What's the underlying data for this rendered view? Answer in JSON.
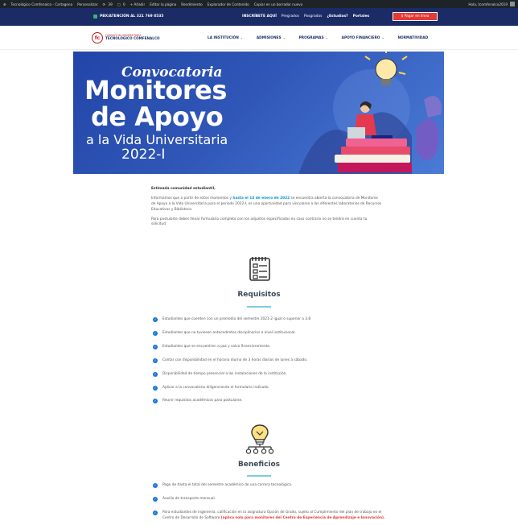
{
  "admin_bar": {
    "items": [
      "Tecnológico Comfenalco - Cartagena",
      "Personalizar",
      "39",
      "0",
      "+ Añadir",
      "Editar la página",
      "Rendimiento",
      "Explorador de Contenido",
      "Copiar en un borrador nuevo"
    ],
    "greeting": "Hola, tcomfenalco2019"
  },
  "topbar": {
    "pbx": "PBX/ATENCIÓN AL 321 769 8535",
    "signup_label": "INSCRÍBETE AQUÍ",
    "links": [
      "Pregrados",
      "Posgrados",
      "¿Estudias?",
      "Portales"
    ],
    "enroll_button": "$ Pagar en línea"
  },
  "navbar": {
    "logo_line1": "FUNDACIÓN UNIVERSITARIA",
    "logo_line2": "TECNOLÓGICO COMFENALCO",
    "menu": [
      "LA INSTITUCIÓN",
      "ADMISIONES",
      "PROGRAMAS",
      "APOYO FINANCIERO",
      "NORMATIVIDAD"
    ],
    "menu_has_caret": [
      true,
      true,
      true,
      true,
      false
    ]
  },
  "hero": {
    "line1": "Convocatoria",
    "line2": "Monitores",
    "line3": "de Apoyo",
    "line4": "a la Vida Universitaria",
    "line5": "2022-I"
  },
  "intro": {
    "greeting": "Estimada comunidad estudiantil,",
    "p1_a": "Informamos que a partir de estos momentos y ",
    "p1_highlight": "hasta el 14 de enero de 2022",
    "p1_b": " se encuentra abierta la convocatoria de Monitores de Apoyo a la Vida Universitaria para el periodo 2022-I, es una oportunidad para vincularse a las diferentes laboratorios de Recursos Educativos y Biblioteca.",
    "p2": "Para postularte debes llenar formulario completo con los adjuntos especificados en caso contrario no se tendrá en cuenta tu solicitud."
  },
  "requisitos": {
    "title": "Requisitos",
    "items": [
      "Estudiantes que cuenten con un promedio del semestre 2021-2 igual o superior a 3.8",
      "Estudiantes que no tuviesen antecedentes disciplinarios a nivel institucional.",
      "Estudiantes que se encuentren a paz y salvo financieramente.",
      "Contar con disponibilidad en el horario diurno de 3 horas diarias de lunes a sábado.",
      "Disponibilidad de tiempo presencial a las instalaciones de la institución.",
      "Aplicar a la convocatoria diligenciando el formulario indicado.",
      "Reunir requisitos académicos para postularse."
    ]
  },
  "beneficios": {
    "title": "Beneficios",
    "items": [
      "Pago de hasta el total del semestre académico de una carrera tecnológica.",
      "Auxilio de transporte mensual.",
      "Para estudiantes de ingeniería, calificación en la asignatura Opción de Grado, sujeto al Cumplimiento del plan de trabajo en el Centro de Desarrollo de Software"
    ],
    "item3_red": "(aplica solo para monitores del Centro de Experiencia de Aprendizaje e Innovación)."
  },
  "colors": {
    "brand_navy": "#1a2b66",
    "accent_red": "#e53935",
    "hero_blue": "#2145a8",
    "check_blue": "#1976d2",
    "highlight": "#0095d5"
  }
}
